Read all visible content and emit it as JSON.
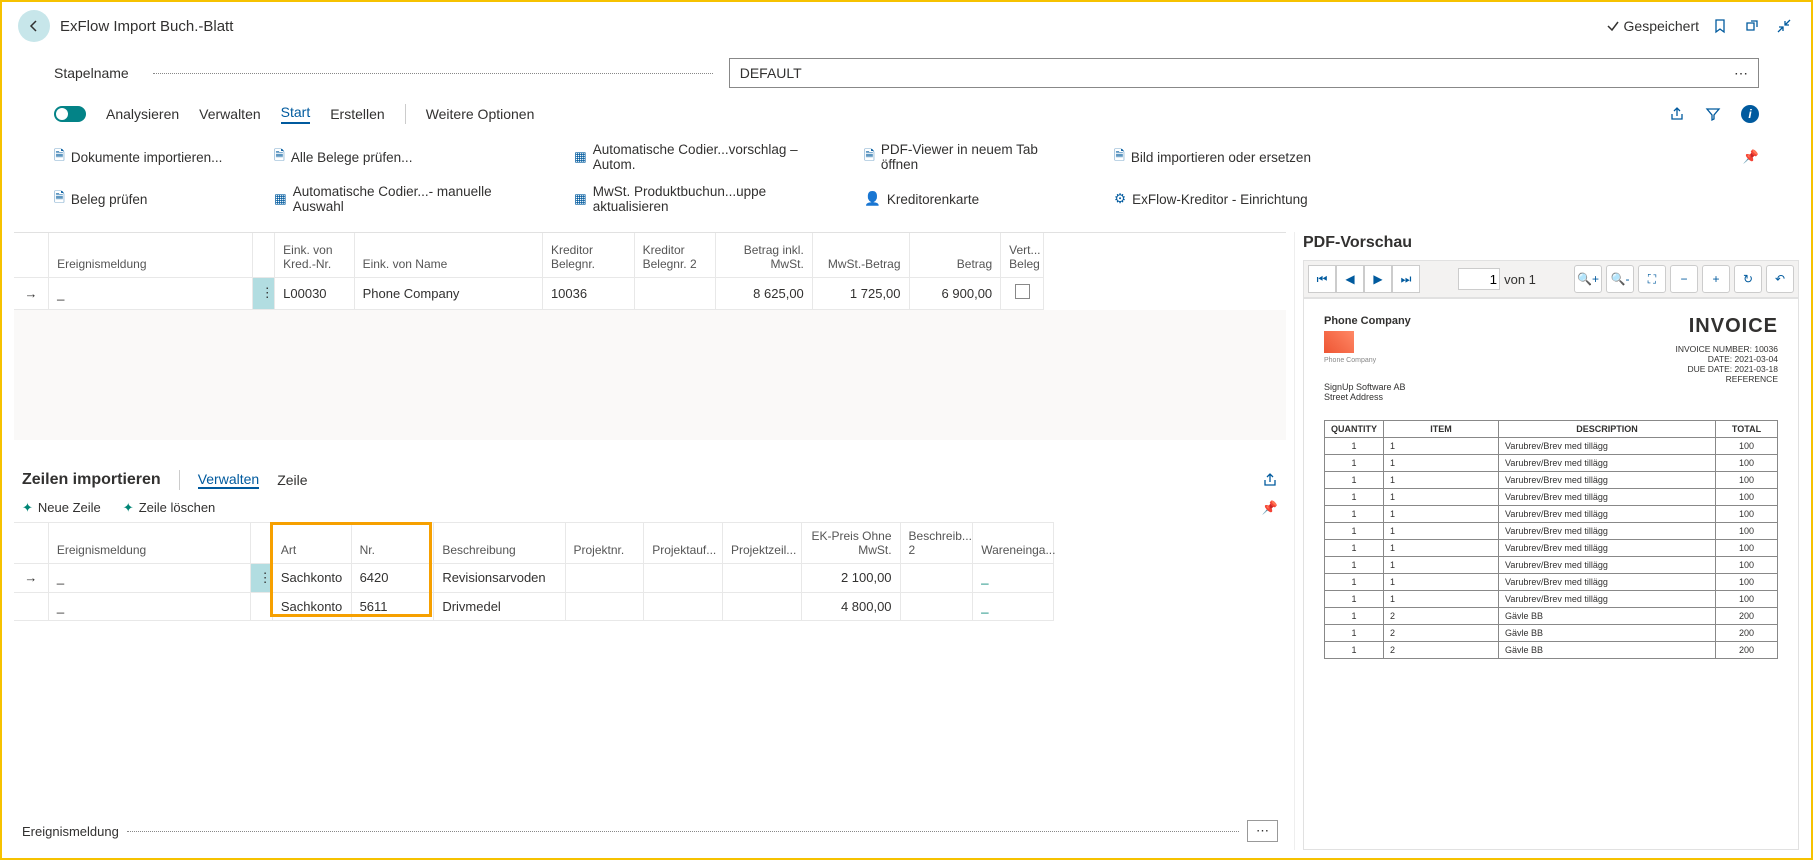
{
  "header": {
    "title": "ExFlow Import Buch.-Blatt",
    "saved": "Gespeichert"
  },
  "batch": {
    "label": "Stapelname",
    "value": "DEFAULT"
  },
  "cmd": {
    "analyze": "Analysieren",
    "manage": "Verwalten",
    "start": "Start",
    "create": "Erstellen",
    "more": "Weitere Optionen"
  },
  "actions": {
    "row1": [
      "Dokumente importieren...",
      "Alle Belege prüfen...",
      "Automatische Codier...vorschlag – Autom.",
      "PDF-Viewer in neuem Tab öffnen",
      "Bild importieren oder ersetzen"
    ],
    "row2": [
      "Beleg prüfen",
      "Automatische Codier...- manuelle Auswahl",
      "MwSt. Produktbuchun...uppe aktualisieren",
      "Kreditorenkarte",
      "ExFlow-Kreditor - Einrichtung"
    ]
  },
  "hcols": {
    "c1": "Ereignismeldung",
    "c2": "Eink. von Kred.-Nr.",
    "c3": "Eink. von Name",
    "c4": "Kreditor Belegnr.",
    "c5": "Kreditor Belegnr. 2",
    "c6": "Betrag inkl. MwSt.",
    "c7": "MwSt.-Betrag",
    "c8": "Betrag",
    "c9": "Vert... Beleg"
  },
  "hrow": {
    "msg": "_",
    "vendno": "L00030",
    "name": "Phone Company",
    "doc": "10036",
    "doc2": "",
    "incl": "8 625,00",
    "vat": "1 725,00",
    "amt": "6 900,00"
  },
  "linesHdr": {
    "title": "Zeilen importieren",
    "manage": "Verwalten",
    "line": "Zeile",
    "new": "Neue Zeile",
    "delete": "Zeile löschen"
  },
  "lcols": {
    "c1": "Ereignismeldung",
    "c2": "Art",
    "c3": "Nr.",
    "c4": "Beschreibung",
    "c5": "Projektnr.",
    "c6": "Projektauf...",
    "c7": "Projektzeil...",
    "c8": "EK-Preis Ohne MwSt.",
    "c9": "Beschreib... 2",
    "c10": "Wareneinga..."
  },
  "lrows": [
    {
      "msg": "_",
      "art": "Sachkonto",
      "nr": "6420",
      "desc": "Revisionsarvoden",
      "price": "2 100,00",
      "we": "_"
    },
    {
      "msg": "_",
      "art": "Sachkonto",
      "nr": "5611",
      "desc": "Drivmedel",
      "price": "4 800,00",
      "we": "_"
    }
  ],
  "bottomLabel": "Ereignismeldung",
  "pdf": {
    "title": "PDF-Vorschau",
    "page": "1",
    "of": "von 1",
    "company": "Phone Company",
    "logoSub": "Phone Company",
    "addr1": "SignUp Software AB",
    "addr2": "Street Address",
    "invTitle": "INVOICE",
    "meta1": "INVOICE NUMBER: 10036",
    "meta2": "DATE: 2021-03-04",
    "meta3": "DUE DATE: 2021-03-18",
    "meta4": "REFERENCE",
    "th": {
      "q": "QUANTITY",
      "i": "ITEM",
      "d": "DESCRIPTION",
      "t": "TOTAL"
    },
    "rows": [
      {
        "q": "1",
        "i": "1",
        "d": "Varubrev/Brev med tillägg",
        "t": "100"
      },
      {
        "q": "1",
        "i": "1",
        "d": "Varubrev/Brev med tillägg",
        "t": "100"
      },
      {
        "q": "1",
        "i": "1",
        "d": "Varubrev/Brev med tillägg",
        "t": "100"
      },
      {
        "q": "1",
        "i": "1",
        "d": "Varubrev/Brev med tillägg",
        "t": "100"
      },
      {
        "q": "1",
        "i": "1",
        "d": "Varubrev/Brev med tillägg",
        "t": "100"
      },
      {
        "q": "1",
        "i": "1",
        "d": "Varubrev/Brev med tillägg",
        "t": "100"
      },
      {
        "q": "1",
        "i": "1",
        "d": "Varubrev/Brev med tillägg",
        "t": "100"
      },
      {
        "q": "1",
        "i": "1",
        "d": "Varubrev/Brev med tillägg",
        "t": "100"
      },
      {
        "q": "1",
        "i": "1",
        "d": "Varubrev/Brev med tillägg",
        "t": "100"
      },
      {
        "q": "1",
        "i": "1",
        "d": "Varubrev/Brev med tillägg",
        "t": "100"
      },
      {
        "q": "1",
        "i": "2",
        "d": "Gävle BB",
        "t": "200"
      },
      {
        "q": "1",
        "i": "2",
        "d": "Gävle BB",
        "t": "200"
      },
      {
        "q": "1",
        "i": "2",
        "d": "Gävle BB",
        "t": "200"
      }
    ]
  }
}
